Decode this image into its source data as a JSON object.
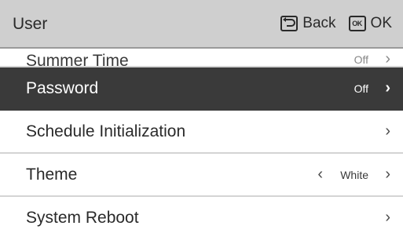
{
  "header": {
    "title": "User",
    "back_label": "Back",
    "ok_label": "OK",
    "ok_key_text": "OK"
  },
  "menu": {
    "items": [
      {
        "label": "Summer Time",
        "value": "Off",
        "partial": true
      },
      {
        "label": "Password",
        "value": "Off",
        "selected": true
      },
      {
        "label": "Schedule Initialization",
        "value": ""
      },
      {
        "label": "Theme",
        "value": "White",
        "has_left": true
      },
      {
        "label": "System Reboot",
        "value": ""
      }
    ]
  },
  "colors": {
    "header_bg": "#cfcfcf",
    "selected_bg": "#3a3a3a",
    "divider": "#d4d4d4"
  }
}
